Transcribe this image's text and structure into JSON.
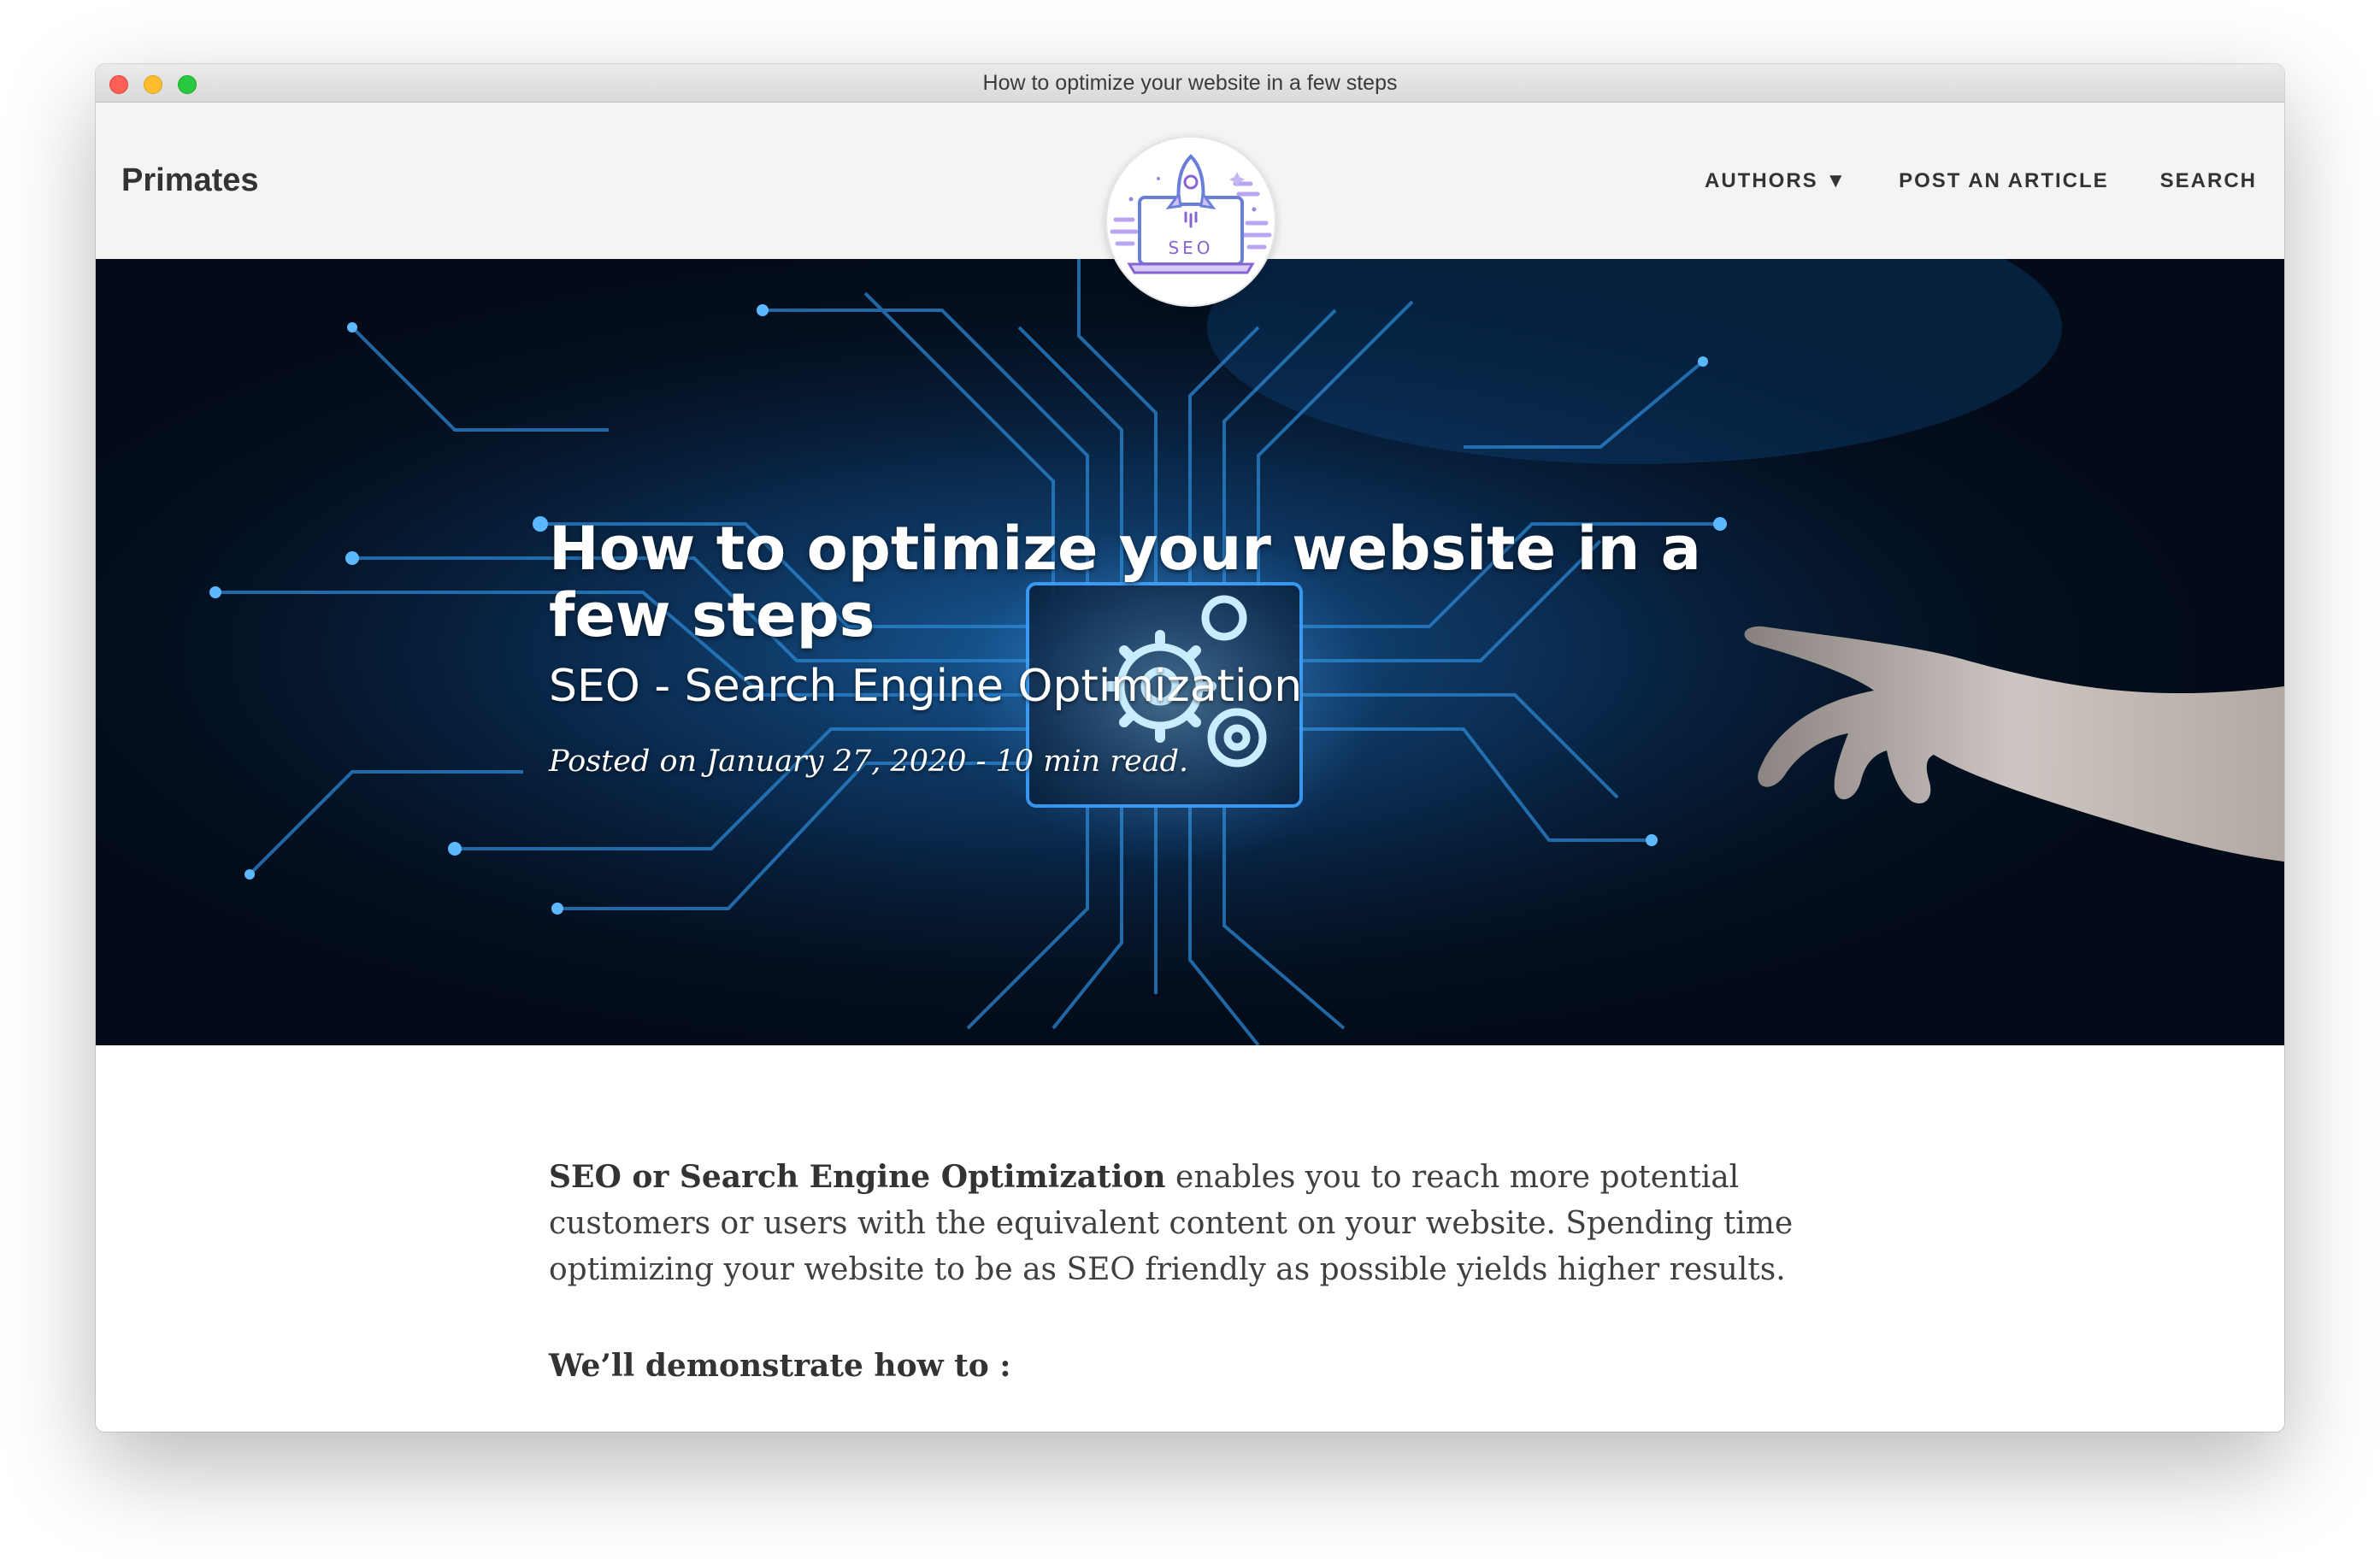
{
  "window": {
    "title": "How to optimize your website in a few steps"
  },
  "navbar": {
    "brand": "Primates",
    "logo_text": "SEO",
    "links": [
      {
        "label": "AUTHORS ▼"
      },
      {
        "label": "POST AN ARTICLE"
      },
      {
        "label": "SEARCH"
      }
    ]
  },
  "hero": {
    "title": "How to optimize your website in a few steps",
    "subtitle": "SEO - Search Engine Optimization",
    "meta": "Posted on January 27, 2020 - 10 min read."
  },
  "article": {
    "lead_bold": "SEO or Search Engine Optimization",
    "lead_rest": " enables you to reach more potential customers or users with the equivalent content on your website. Spending time optimizing your website to be as SEO friendly as possible yields higher results.",
    "demo_heading": "We’ll demonstrate how to :"
  },
  "colors": {
    "accent_blue": "#3fa0ff",
    "logo_purple": "#8a63d2",
    "text_dark": "#333333"
  }
}
